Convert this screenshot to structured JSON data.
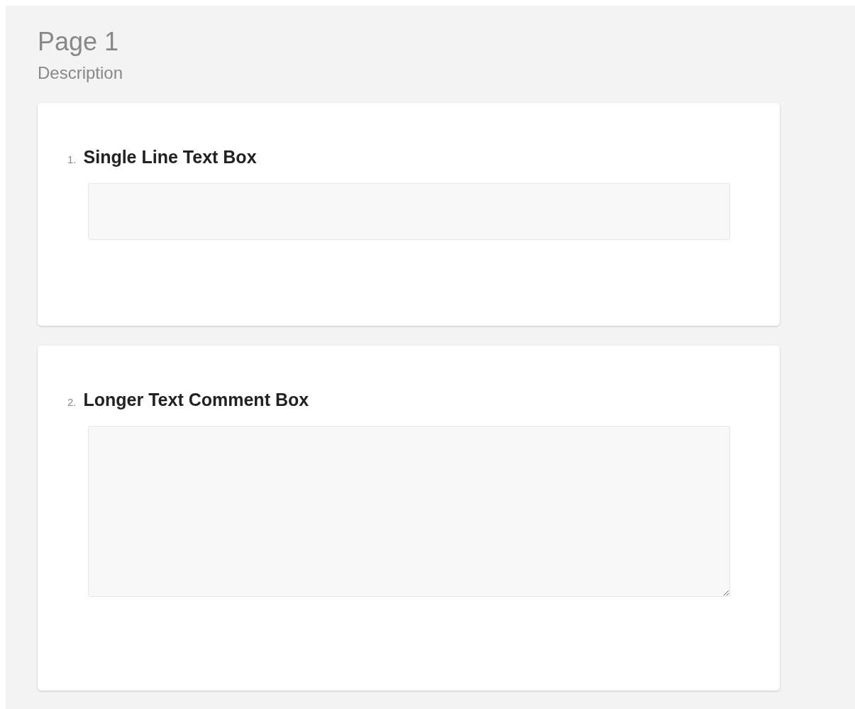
{
  "page": {
    "title": "Page 1",
    "description": "Description"
  },
  "questions": [
    {
      "number": "1.",
      "title": "Single Line Text Box",
      "kind": "single_line"
    },
    {
      "number": "2.",
      "title": "Longer Text Comment Box",
      "kind": "comment"
    }
  ]
}
